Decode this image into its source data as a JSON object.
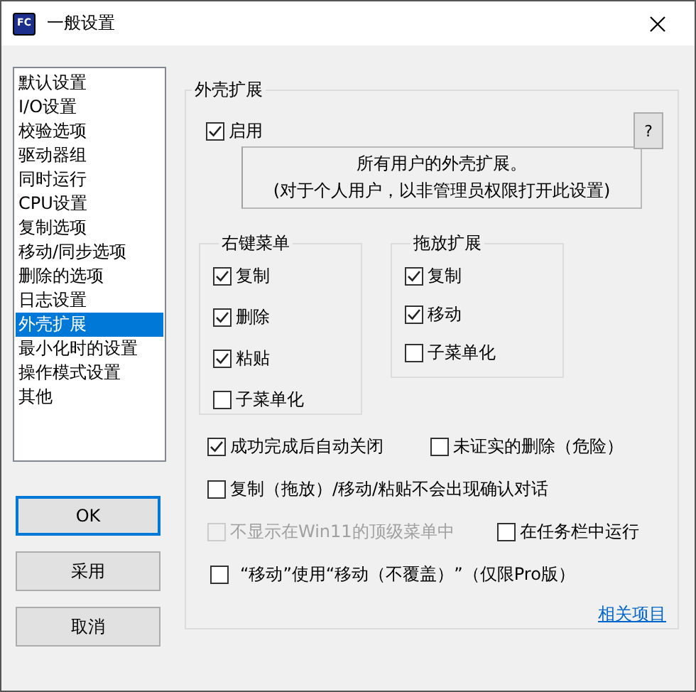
{
  "window": {
    "title": "一般设置",
    "icon_text": "FC"
  },
  "sidebar": {
    "items": [
      {
        "label": "默认设置",
        "selected": false
      },
      {
        "label": "I/O设置",
        "selected": false
      },
      {
        "label": "校验选项",
        "selected": false
      },
      {
        "label": "驱动器组",
        "selected": false
      },
      {
        "label": "同时运行",
        "selected": false
      },
      {
        "label": "CPU设置",
        "selected": false
      },
      {
        "label": "复制选项",
        "selected": false
      },
      {
        "label": "移动/同步选项",
        "selected": false
      },
      {
        "label": "删除的选项",
        "selected": false
      },
      {
        "label": "日志设置",
        "selected": false
      },
      {
        "label": "外壳扩展",
        "selected": true
      },
      {
        "label": "最小化时的设置",
        "selected": false
      },
      {
        "label": "操作模式设置",
        "selected": false
      },
      {
        "label": "其他",
        "selected": false
      }
    ]
  },
  "buttons": [
    {
      "label": "OK",
      "default": true
    },
    {
      "label": "采用",
      "default": false
    },
    {
      "label": "取消",
      "default": false
    }
  ],
  "panel": {
    "title": "外壳扩展",
    "help_button": "?",
    "enable": {
      "label": "启用",
      "checked": true
    },
    "info_lines": [
      "所有用户的外壳扩展。",
      "(对于个人用户，以非管理员权限打开此设置)"
    ],
    "context_menu": {
      "title": "右键菜单",
      "items": [
        {
          "label": "复制",
          "checked": true
        },
        {
          "label": "删除",
          "checked": true
        },
        {
          "label": "粘贴",
          "checked": true
        },
        {
          "label": "子菜单化",
          "checked": false
        }
      ]
    },
    "drag_drop": {
      "title": "拖放扩展",
      "items": [
        {
          "label": "复制",
          "checked": true
        },
        {
          "label": "移动",
          "checked": true
        },
        {
          "label": "子菜单化",
          "checked": false
        }
      ]
    },
    "options": [
      [
        {
          "label": "成功完成后自动关闭",
          "checked": true,
          "disabled": false
        },
        {
          "label": "未证实的删除（危险）",
          "checked": false,
          "disabled": false
        }
      ],
      [
        {
          "label": "复制（拖放）/移动/粘贴不会出现确认对话",
          "checked": false,
          "disabled": false
        }
      ],
      [
        {
          "label": "不显示在Win11的顶级菜单中",
          "checked": false,
          "disabled": true
        },
        {
          "label": "在任务栏中运行",
          "checked": false,
          "disabled": false
        }
      ],
      [
        {
          "label": "“移动”使用“移动（不覆盖）”（仅限Pro版）",
          "checked": false,
          "disabled": false
        }
      ]
    ],
    "link": "相关项目"
  }
}
